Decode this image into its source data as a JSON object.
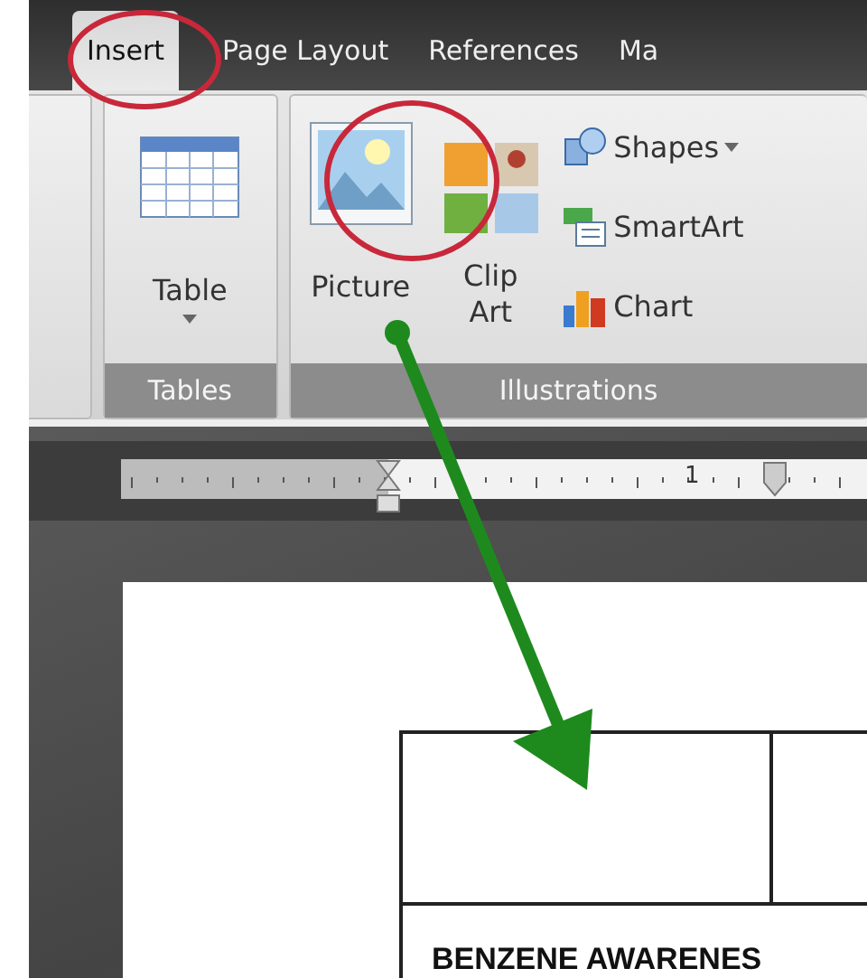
{
  "tabs": [
    {
      "label": "Insert",
      "selected": true
    },
    {
      "label": "Page Layout",
      "selected": false
    },
    {
      "label": "References",
      "selected": false
    },
    {
      "label": "Ma",
      "selected": false
    }
  ],
  "groups": [
    {
      "kind": "tables",
      "label": "Tables",
      "buttons": [
        {
          "kind": "table",
          "label": "Table"
        }
      ]
    },
    {
      "kind": "illustrations",
      "label": "Illustrations",
      "buttons": [
        {
          "kind": "picture",
          "label": "Picture"
        },
        {
          "kind": "clipart",
          "label": "Clip Art"
        },
        {
          "kind": "shapes",
          "label": "Shapes"
        },
        {
          "kind": "smartart",
          "label": "SmartArt"
        },
        {
          "kind": "chart",
          "label": "Chart"
        }
      ]
    }
  ],
  "ruler": {
    "label": "1"
  },
  "document": {
    "table": {
      "rows": [
        [
          "",
          ""
        ],
        [
          "BENZENE AWARENES"
        ]
      ]
    }
  }
}
